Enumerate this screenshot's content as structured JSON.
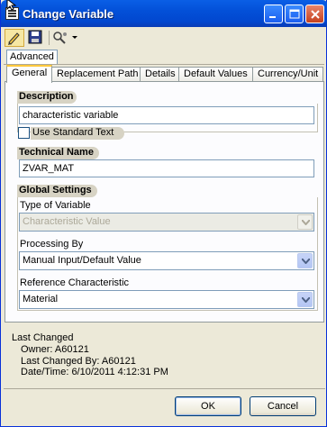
{
  "window": {
    "title": "Change Variable"
  },
  "toolbar": {
    "edit_icon": "edit-pencil-icon",
    "save_icon": "floppy-disk-icon",
    "other_icon": "tools-dropdown-icon"
  },
  "top_tab": {
    "label": "Advanced"
  },
  "tabs": [
    {
      "label": "General",
      "active": true
    },
    {
      "label": "Replacement Path"
    },
    {
      "label": "Details"
    },
    {
      "label": "Default Values"
    },
    {
      "label": "Currency/Unit"
    }
  ],
  "description": {
    "heading": "Description",
    "value": "characteristic variable",
    "use_standard_text": {
      "label": "Use Standard Text",
      "checked": false
    }
  },
  "technical_name": {
    "heading": "Technical Name",
    "value": "ZVAR_MAT"
  },
  "global_settings": {
    "heading": "Global Settings",
    "type_label": "Type of Variable",
    "type_value": "Characteristic Value",
    "processing_label": "Processing By",
    "processing_value": "Manual Input/Default Value",
    "reference_label": "Reference Characteristic",
    "reference_value": "Material"
  },
  "last_changed": {
    "heading": "Last Changed",
    "owner": "Owner: A60121",
    "changed_by": "Last Changed By: A60121",
    "datetime": "Date/Time: 6/10/2011 4:12:31 PM"
  },
  "buttons": {
    "ok": "OK",
    "cancel": "Cancel"
  },
  "colors": {
    "title_bar": "#0350d8",
    "active_tab_accent": "#ffc83c",
    "dialog_bg": "#ece9d8"
  }
}
